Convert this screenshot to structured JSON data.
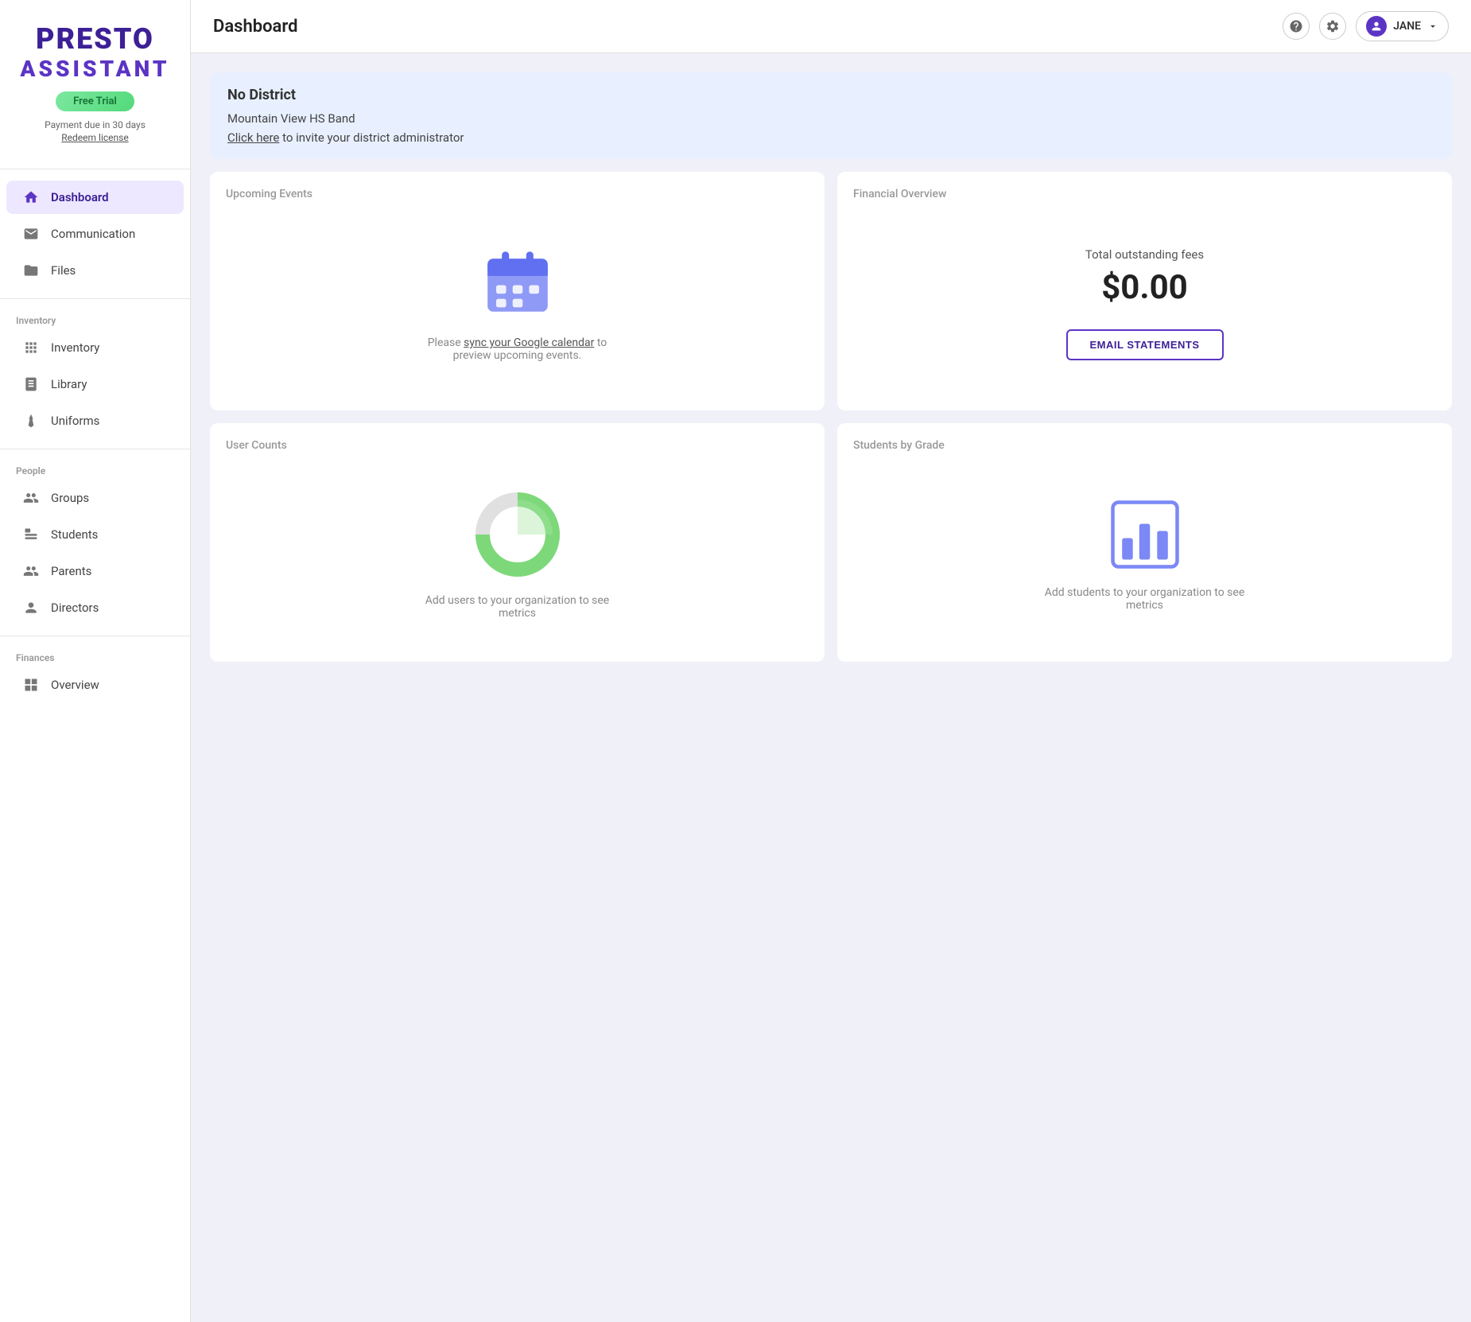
{
  "app": {
    "name_presto": "PRESTO",
    "name_assistant": "ASSISTANT"
  },
  "trial": {
    "badge": "Free Trial",
    "payment_info": "Payment due in 30 days",
    "redeem": "Redeem license"
  },
  "sidebar": {
    "nav_items": [
      {
        "id": "dashboard",
        "label": "Dashboard",
        "icon": "home",
        "active": true,
        "section": null
      },
      {
        "id": "communication",
        "label": "Communication",
        "icon": "mail",
        "active": false,
        "section": null
      },
      {
        "id": "files",
        "label": "Files",
        "icon": "folder",
        "active": false,
        "section": null
      }
    ],
    "sections": [
      {
        "label": "Inventory",
        "items": [
          {
            "id": "inventory",
            "label": "Inventory",
            "icon": "grid"
          },
          {
            "id": "library",
            "label": "Library",
            "icon": "book"
          },
          {
            "id": "uniforms",
            "label": "Uniforms",
            "icon": "tie"
          }
        ]
      },
      {
        "label": "People",
        "items": [
          {
            "id": "groups",
            "label": "Groups",
            "icon": "groups"
          },
          {
            "id": "students",
            "label": "Students",
            "icon": "students"
          },
          {
            "id": "parents",
            "label": "Parents",
            "icon": "parents"
          },
          {
            "id": "directors",
            "label": "Directors",
            "icon": "directors"
          }
        ]
      },
      {
        "label": "Finances",
        "items": [
          {
            "id": "overview",
            "label": "Overview",
            "icon": "overview"
          }
        ]
      }
    ]
  },
  "topbar": {
    "title": "Dashboard",
    "user_name": "JANE"
  },
  "dashboard": {
    "district_banner": {
      "heading": "No District",
      "org_name": "Mountain View HS Band",
      "invite_text": "to invite your district administrator",
      "invite_link": "Click here"
    },
    "upcoming_events": {
      "title": "Upcoming Events",
      "subtitle": "to preview upcoming events.",
      "subtitle_link": "sync your Google calendar",
      "subtitle_prefix": "Please"
    },
    "financial_overview": {
      "title": "Financial Overview",
      "total_label": "Total outstanding fees",
      "amount": "$0.00",
      "button": "EMAIL STATEMENTS"
    },
    "user_counts": {
      "title": "User Counts",
      "subtitle": "Add users to your organization to see metrics"
    },
    "students_by_grade": {
      "title": "Students by Grade",
      "subtitle": "Add students to your organization to see metrics"
    }
  }
}
